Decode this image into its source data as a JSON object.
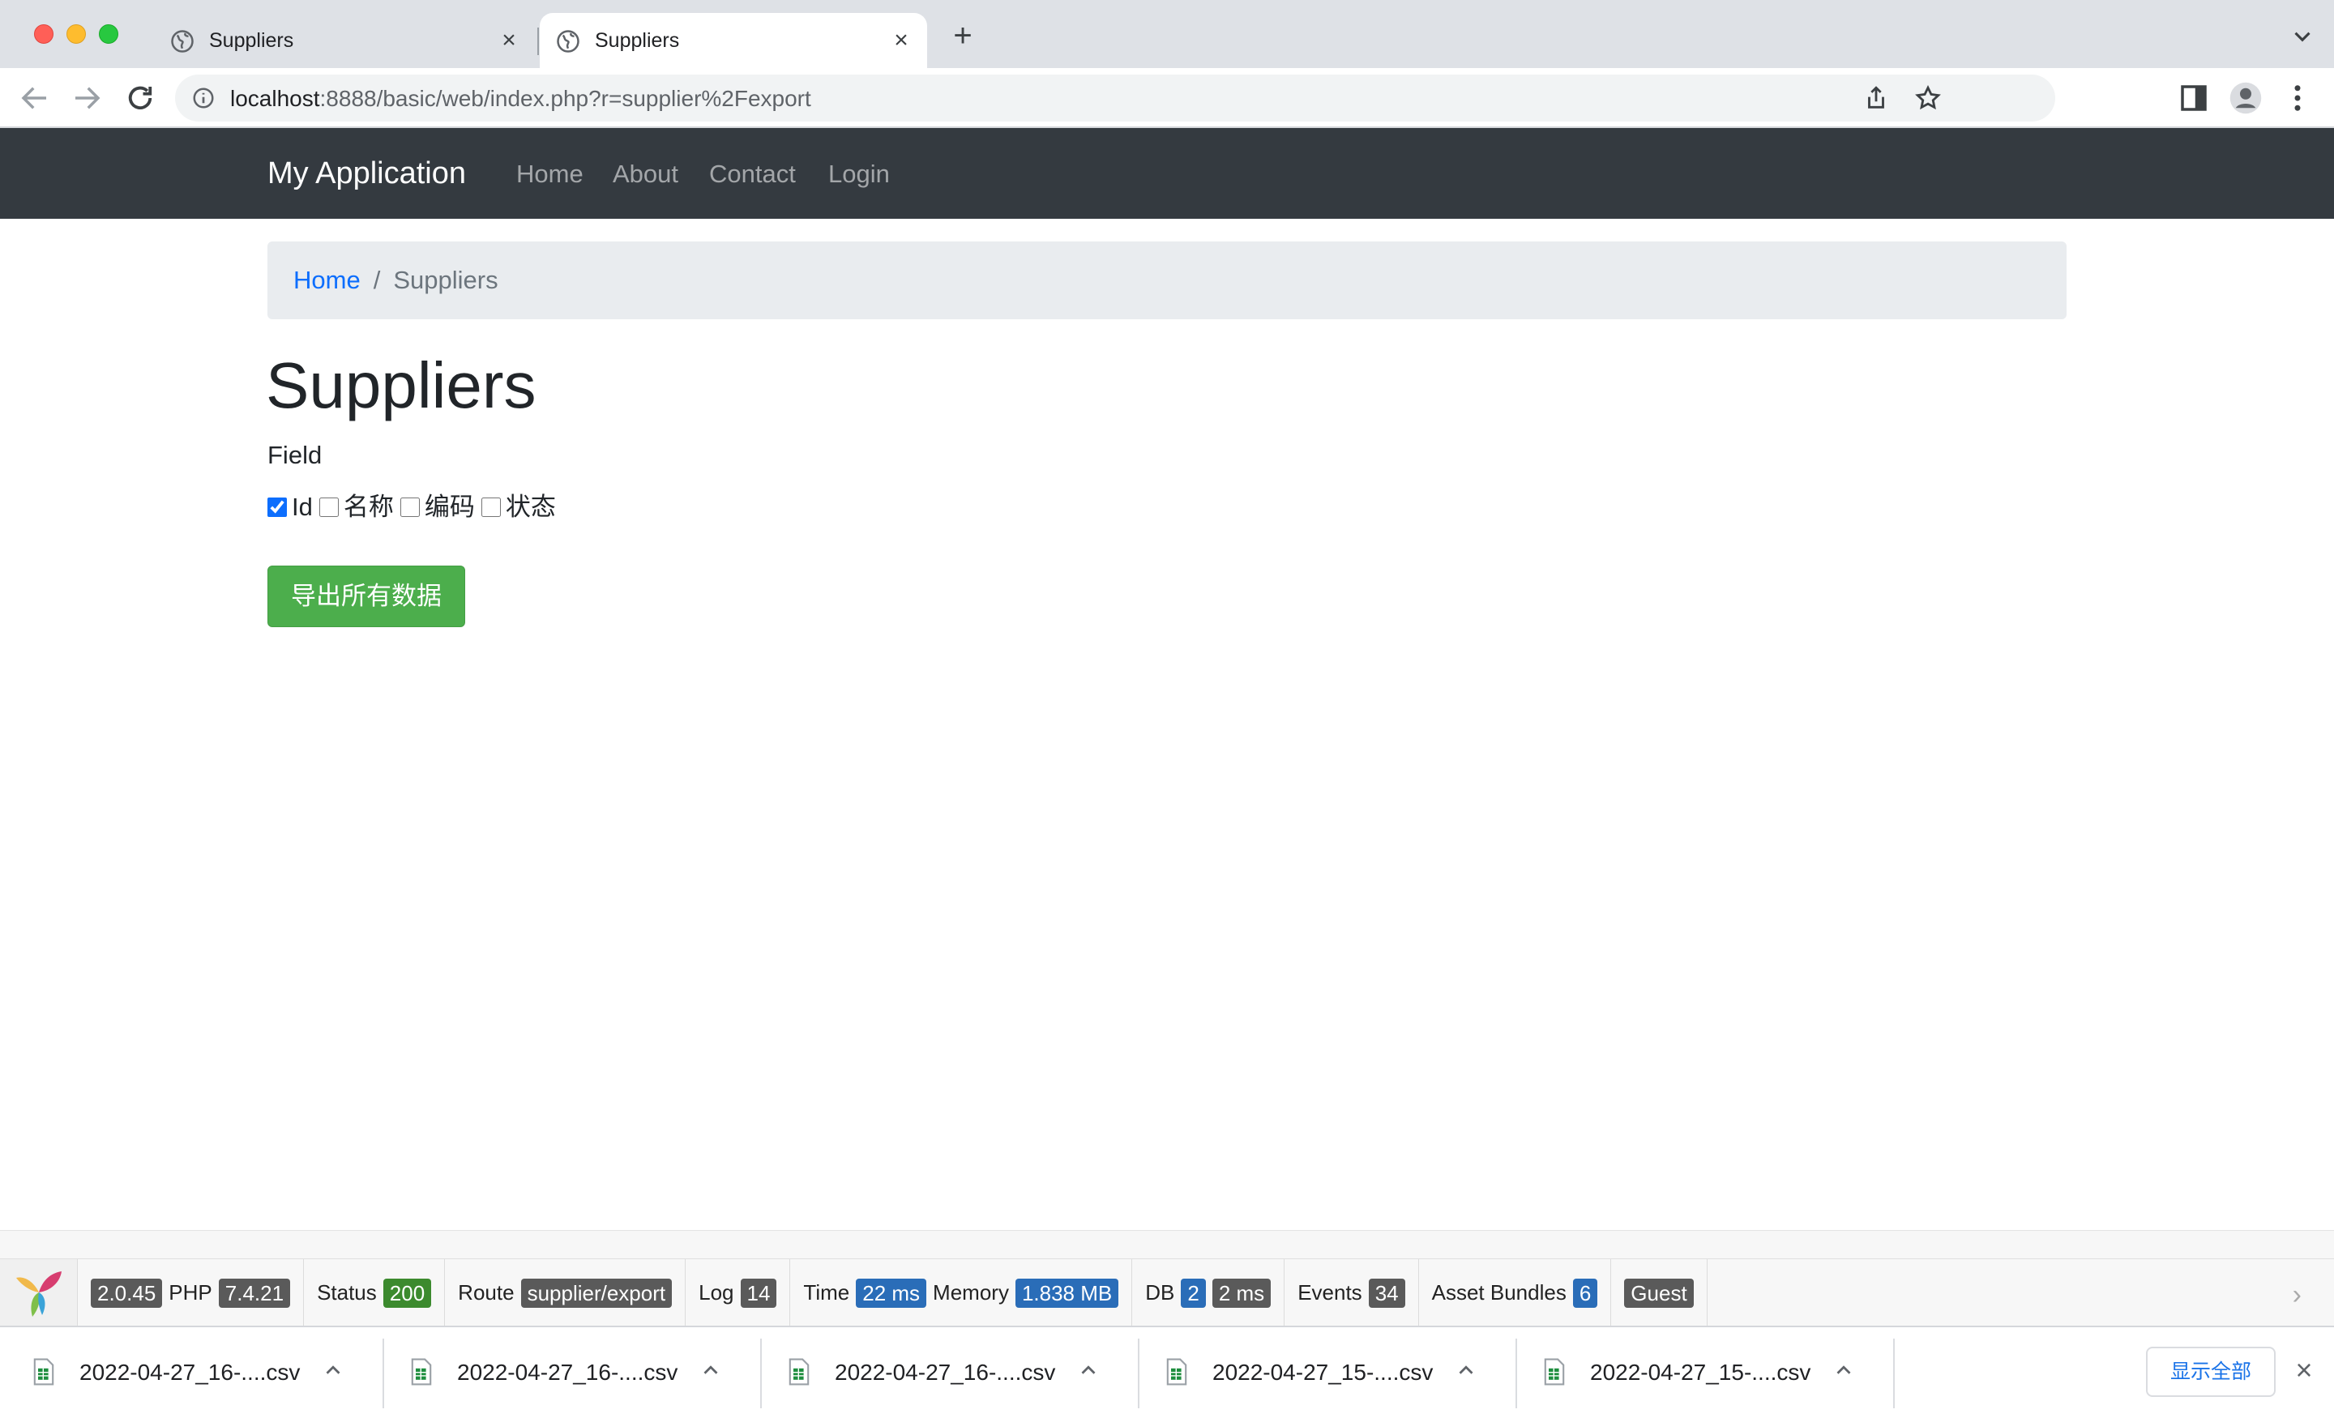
{
  "browser": {
    "tabs": [
      {
        "title": "Suppliers",
        "active": false
      },
      {
        "title": "Suppliers",
        "active": true
      }
    ],
    "new_tab_label": "+",
    "tab_close_label": "×",
    "url_host": "localhost",
    "url_rest": ":8888/basic/web/index.php?r=supplier%2Fexport"
  },
  "app": {
    "brand": "My Application",
    "nav": [
      "Home",
      "About",
      "Contact",
      "Login"
    ]
  },
  "breadcrumb": {
    "home": "Home",
    "separator": "/",
    "current": "Suppliers"
  },
  "page": {
    "title": "Suppliers",
    "field_label": "Field",
    "fields": [
      {
        "label": "Id",
        "checked": true
      },
      {
        "label": "名称",
        "checked": false
      },
      {
        "label": "编码",
        "checked": false
      },
      {
        "label": "状态",
        "checked": false
      }
    ],
    "export_button": "导出所有数据"
  },
  "debug_toolbar": {
    "yii_version": "2.0.45",
    "php_label": "PHP",
    "php_version": "7.4.21",
    "status_label": "Status",
    "status_code": "200",
    "route_label": "Route",
    "route": "supplier/export",
    "log_label": "Log",
    "log_count": "14",
    "time_label": "Time",
    "time": "22 ms",
    "memory_label": "Memory",
    "memory": "1.838 MB",
    "db_label": "DB",
    "db_queries": "2",
    "db_time": "2 ms",
    "events_label": "Events",
    "events": "34",
    "assets_label": "Asset Bundles",
    "assets": "6",
    "user": "Guest",
    "collapse_glyph": "›"
  },
  "downloads": {
    "files": [
      "2022-04-27_16-....csv",
      "2022-04-27_16-....csv",
      "2022-04-27_16-....csv",
      "2022-04-27_15-....csv",
      "2022-04-27_15-....csv"
    ],
    "show_all": "显示全部",
    "close_glyph": "×"
  },
  "colors": {
    "navbar": "#343a40",
    "link": "#0d6efd",
    "export_button": "#4cae4c",
    "status_badge": "#3c8a2e",
    "info_badge": "#2a6db8"
  }
}
